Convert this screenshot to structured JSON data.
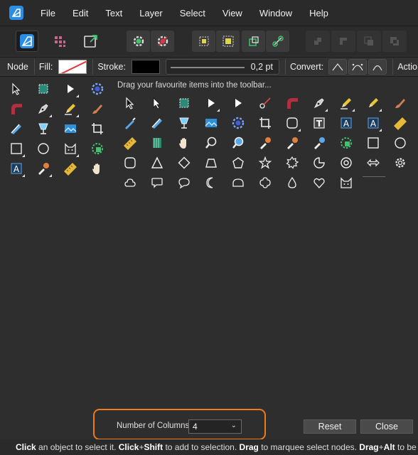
{
  "menu": {
    "items": [
      "File",
      "Edit",
      "Text",
      "Layer",
      "Select",
      "View",
      "Window",
      "Help"
    ]
  },
  "context": {
    "node_label": "Node",
    "fill_label": "Fill:",
    "stroke_label": "Stroke:",
    "stroke_value": "0,2 pt",
    "convert_label": "Convert:",
    "action_label": "Actio"
  },
  "customize": {
    "hint": "Drag your favourite items into the toolbar...",
    "columns_label": "Number of Columns:",
    "columns_value": "4",
    "reset_label": "Reset",
    "close_label": "Close"
  },
  "status": {
    "p1": "Click",
    "t1": " an object to select it. ",
    "p2": "Click",
    "t2": "+",
    "p3": "Shift",
    "t3": " to add to selection. ",
    "p4": "Drag",
    "t4": " to marquee select nodes. ",
    "p5": "Drag",
    "t5": "+",
    "p6": "Alt",
    "t6": " to be"
  },
  "colors": {
    "accent": "#2b8ee6",
    "highlight": "#ee7a1b",
    "background": "#2e2e2e"
  }
}
